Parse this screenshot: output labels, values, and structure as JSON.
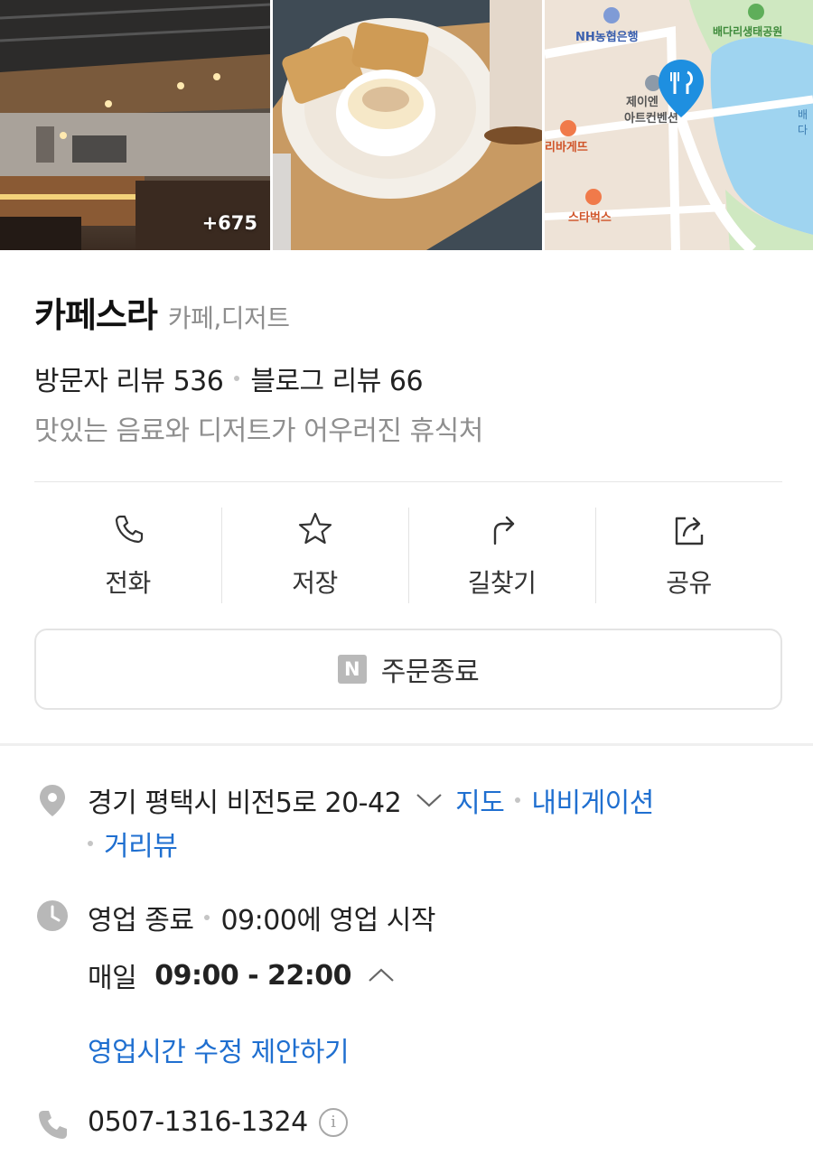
{
  "photos": {
    "more_count": "+675",
    "map_labels": {
      "bank": "NH농협은행",
      "park": "배다리생태공원",
      "venue_line1": "제이엔",
      "venue_line2": "아트컨벤션",
      "bakery": "리바게뜨",
      "starbucks": "스타벅스",
      "edge": "배다"
    }
  },
  "place": {
    "name": "카페스라",
    "category": "카페,디저트",
    "visitor_reviews": "방문자 리뷰 536",
    "blog_reviews": "블로그 리뷰 66",
    "description": "맛있는 음료와 디저트가 어우러진 휴식처"
  },
  "actions": [
    {
      "label": "전화",
      "icon": "phone-icon"
    },
    {
      "label": "저장",
      "icon": "star-icon"
    },
    {
      "label": "길찾기",
      "icon": "directions-icon"
    },
    {
      "label": "공유",
      "icon": "share-icon"
    }
  ],
  "order": {
    "badge": "N",
    "label": "주문종료"
  },
  "address": {
    "text": "경기 평택시 비전5로 20-42",
    "map_link": "지도",
    "navigation_link": "내비게이션",
    "street_view_link": "거리뷰"
  },
  "hours": {
    "status": "영업 종료",
    "next_open": "09:00에 영업 시작",
    "day": "매일",
    "range": "09:00 - 22:00",
    "suggest_link": "영업시간 수정 제안하기"
  },
  "phone": {
    "number": "0507-1316-1324",
    "info_glyph": "i"
  },
  "colors": {
    "link": "#1f6fd0",
    "map_pin": "#1e8fe0",
    "map_water": "#9fd4f0"
  }
}
